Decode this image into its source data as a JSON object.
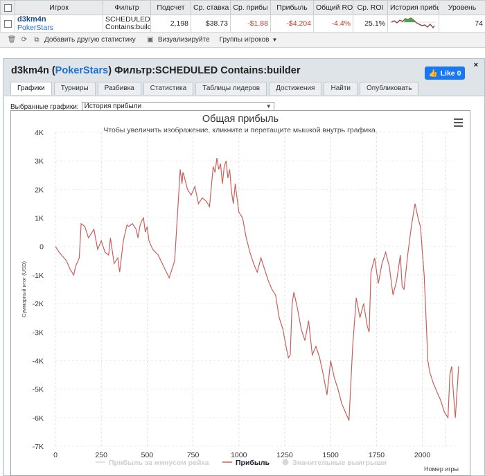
{
  "table": {
    "headers": [
      "",
      "Игрок",
      "Фильтр",
      "Подсчет",
      "Ср. ставка",
      "Ср. прибы",
      "Прибыль",
      "Общий RO",
      "Ср. ROI",
      "История прибы",
      "Уровень"
    ],
    "row": {
      "player": "d3km4n",
      "site": "PokerStars",
      "filter_line1": "SCHEDULED",
      "filter_line2": "Contains:build",
      "count": "2,198",
      "avg_stake": "$38.73",
      "avg_profit": "-$1.88",
      "profit": "-$4,204",
      "total_roi": "-4.4%",
      "avg_roi": "25.1%",
      "level": "74"
    }
  },
  "toolbar": {
    "add_stat": "Добавить другую статистику",
    "visualize": "Визуализируйте",
    "groups": "Группы игроков"
  },
  "panel": {
    "title_player": "d3km4n",
    "title_site": "PokerStars",
    "title_filter": "Фильтр:SCHEDULED Contains:builder",
    "like": "Like 0",
    "close": "×",
    "tabs": [
      "Графики",
      "Турниры",
      "Разбивка",
      "Статистика",
      "Таблицы лидеров",
      "Достижения",
      "Найти",
      "Опубликовать"
    ],
    "select_label": "Выбранные графики:",
    "select_value": "История прибыли"
  },
  "colors": {
    "line": "#c8605a",
    "accent": "#1877f2",
    "negative": "#c0392b"
  },
  "chart_data": {
    "type": "line",
    "title": "Общая прибыль",
    "subtitle": "Чтобы увеличить изображение, кликните и перетащите мышкой внутрь графика.",
    "xlabel": "Номер игры",
    "ylabel": "Суммарный итог (USD)",
    "xlim": [
      0,
      2198
    ],
    "ylim": [
      -7000,
      4000
    ],
    "x_ticks": [
      0,
      250,
      500,
      750,
      1000,
      1250,
      1500,
      1750,
      2000
    ],
    "y_ticks": [
      4000,
      3000,
      2000,
      1000,
      0,
      -1000,
      -2000,
      -3000,
      -4000,
      -5000,
      -6000,
      -7000
    ],
    "y_tick_labels": [
      "4K",
      "3K",
      "2K",
      "1K",
      "0",
      "-1K",
      "-2K",
      "-3K",
      "-4K",
      "-5K",
      "-6K",
      "-7K"
    ],
    "legend": [
      "Прибыль за минусом рейка",
      "Прибыль",
      "Значительные выигрыши"
    ],
    "legend_placement": "bottom",
    "series": [
      {
        "name": "Прибыль",
        "x": [
          0,
          20,
          40,
          60,
          80,
          100,
          110,
          130,
          140,
          160,
          180,
          210,
          230,
          250,
          270,
          290,
          300,
          320,
          340,
          350,
          370,
          390,
          400,
          420,
          440,
          450,
          460,
          470,
          480,
          490,
          500,
          510,
          530,
          560,
          590,
          620,
          650,
          680,
          690,
          695,
          700,
          720,
          740,
          760,
          780,
          800,
          820,
          840,
          860,
          870,
          880,
          890,
          900,
          910,
          920,
          930,
          940,
          950,
          960,
          970,
          980,
          990,
          1000,
          1020,
          1040,
          1060,
          1080,
          1100,
          1120,
          1140,
          1160,
          1180,
          1200,
          1220,
          1240,
          1260,
          1270,
          1280,
          1290,
          1300,
          1320,
          1340,
          1360,
          1380,
          1400,
          1420,
          1440,
          1460,
          1480,
          1500,
          1520,
          1540,
          1560,
          1580,
          1600,
          1620,
          1640,
          1660,
          1680,
          1700,
          1710,
          1720,
          1740,
          1760,
          1780,
          1800,
          1820,
          1840,
          1860,
          1880,
          1890,
          1900,
          1920,
          1940,
          1960,
          1970,
          1980,
          1990,
          2000,
          2010,
          2020,
          2030,
          2040,
          2060,
          2080,
          2100,
          2120,
          2140,
          2150,
          2160,
          2170,
          2180,
          2198
        ],
        "y": [
          0,
          -200,
          -350,
          -500,
          -800,
          -1000,
          -700,
          -400,
          800,
          700,
          300,
          600,
          -100,
          200,
          -200,
          -300,
          300,
          -600,
          -400,
          -900,
          200,
          750,
          700,
          800,
          600,
          300,
          700,
          900,
          1000,
          500,
          700,
          200,
          -100,
          -300,
          -700,
          -1100,
          -500,
          2700,
          2200,
          2600,
          2500,
          2000,
          1800,
          2100,
          1500,
          1700,
          1600,
          1400,
          2800,
          2600,
          3100,
          2700,
          2900,
          2200,
          2800,
          3000,
          2400,
          2700,
          1900,
          1500,
          2200,
          1700,
          1200,
          1000,
          300,
          -200,
          -600,
          -900,
          -400,
          -800,
          -1200,
          -1500,
          -1700,
          -2500,
          -2900,
          -3600,
          -3900,
          -3800,
          -2000,
          -1600,
          -2200,
          -2900,
          -3300,
          -2600,
          -3800,
          -3500,
          -3900,
          -4500,
          -5200,
          -4000,
          -4600,
          -5000,
          -5500,
          -5800,
          -6100,
          -3500,
          -1800,
          -2500,
          -2000,
          -2800,
          -3000,
          -900,
          -400,
          -1300,
          -600,
          -200,
          -700,
          -1700,
          -1200,
          -300,
          -1400,
          -1500,
          -300,
          700,
          1500,
          1200,
          900,
          700,
          -200,
          -1000,
          -2500,
          -4000,
          -4400,
          -4800,
          -5100,
          -5400,
          -5800,
          -6000,
          -4500,
          -4200,
          -5200,
          -6000,
          -4200
        ]
      }
    ]
  }
}
